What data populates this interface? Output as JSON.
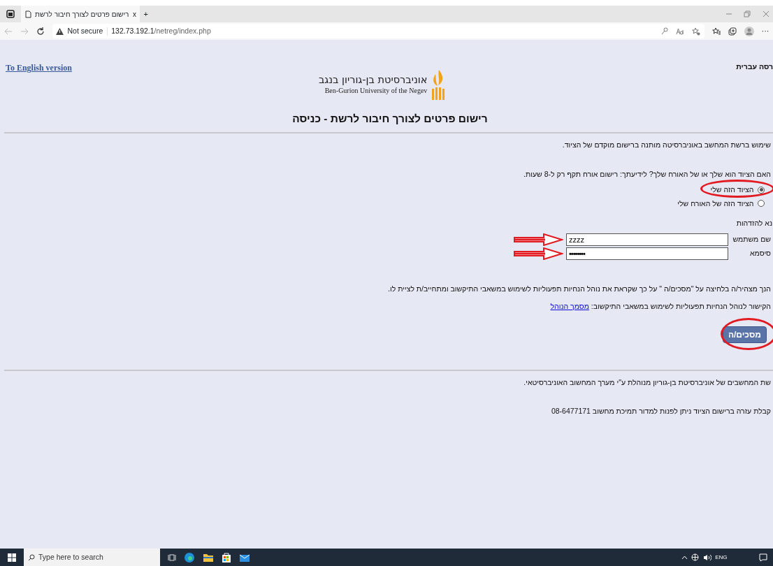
{
  "browser": {
    "tab_title": "רישום פרטים לצורך חיבור לרשת",
    "tab_close": "x",
    "new_tab": "+",
    "security_label": "Not secure",
    "url_host": "132.73.192.1",
    "url_path": "/netreg/index.php",
    "more": "···"
  },
  "page": {
    "english_link": "To English version",
    "hebrew_link": "רסה עברית",
    "logo": {
      "hebrew": "אוניברסיטת בן-גוריון בנגב",
      "english": "Ben-Gurion University of the Negev"
    },
    "title": "רישום פרטים לצורך חיבור לרשת - כניסה",
    "intro": "שימוש ברשת המחשב באוניברסיטה מותנה ברישום מוקדם של הציוד.",
    "question": "האם הציוד הוא שלך או של האורח שלך? לידיעתך: רישום אורח תקף רק ל-8 שעות.",
    "options": [
      {
        "label": "הציוד הזה שלי",
        "selected": true,
        "highlighted": true
      },
      {
        "label": "הציוד הזה של האורח שלי",
        "selected": false,
        "highlighted": false
      }
    ],
    "identify_label": "נא להזדהות",
    "fields": [
      {
        "label": "שם משתמש",
        "value": "zzzz",
        "kind": "text",
        "arrow": true
      },
      {
        "label": "סיסמא",
        "value": "••••••••",
        "kind": "password",
        "arrow": true
      }
    ],
    "declaration": "הנך מצהיר/ה בלחיצה על \"מסכים/ה \" על כך שקראת את נוהל הנחיות תפעוליות לשימוש במשאבי התיקשוב ומתחייב/ת לציית לו.",
    "doc_line": "הקישור לנוהל הנחיות תפעוליות לשימוש במשאבי התיקשוב:",
    "doc_link": "מסמך הנוהל",
    "agree_button": {
      "label": "מסכים/ה",
      "highlighted": true
    },
    "footer": [
      "שת המחשבים של אוניברסיטת בן-גוריון מנוהלת ע\"י מערך המחשוב האוניברסיטאי.",
      "קבלת עזרה ברישום הציוד ניתן לפנות למדור תמיכת מחשוב 08-6477171"
    ]
  },
  "taskbar": {
    "search_placeholder": "Type here to search",
    "language": "ENG"
  }
}
